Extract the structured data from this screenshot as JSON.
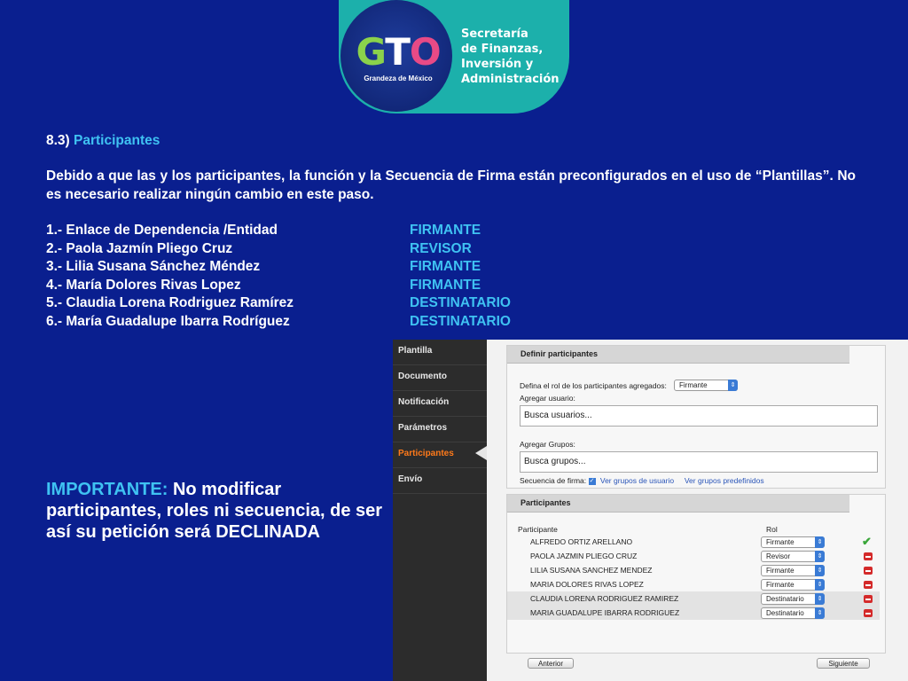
{
  "logo": {
    "brand": "GTO",
    "tagline": "Grandeza de México",
    "secretaria_lines": [
      "Secretaría",
      "de Finanzas,",
      "Inversión y",
      "Administración"
    ]
  },
  "section": {
    "number": "8.3)",
    "title": "Participantes"
  },
  "paragraph": "Debido a que las y los participantes, la función y la Secuencia de Firma están preconfigurados en el uso de “Plantillas”. No es necesario realizar ningún cambio en este paso.",
  "participants_list": [
    {
      "label": "1.- Enlace de Dependencia /Entidad",
      "role": "FIRMANTE"
    },
    {
      "label": "2.- Paola Jazmín Pliego Cruz",
      "role": "REVISOR"
    },
    {
      "label": "3.- Lilia Susana Sánchez Méndez",
      "role": "FIRMANTE"
    },
    {
      "label": "4.- María Dolores Rivas Lopez",
      "role": "FIRMANTE"
    },
    {
      "label": "5.- Claudia Lorena Rodriguez Ramírez",
      "role": "DESTINATARIO"
    },
    {
      "label": "6.- María Guadalupe Ibarra Rodríguez",
      "role": "DESTINATARIO"
    }
  ],
  "important": {
    "prefix": "IMPORTANTE:",
    "text": " No modificar participantes, roles ni secuencia, de ser así su petición será DECLINADA"
  },
  "app": {
    "nav": [
      "Plantilla",
      "Documento",
      "Notificación",
      "Parámetros",
      "Participantes",
      "Envío"
    ],
    "define": {
      "header": "Definir participantes",
      "role_label": "Defina el rol de los participantes agregados:",
      "role_value": "Firmante",
      "add_user_label": "Agregar usuario:",
      "add_user_placeholder": "Busca usuarios...",
      "add_group_label": "Agregar Grupos:",
      "add_group_placeholder": "Busca grupos...",
      "sequence_label": "Secuencia de firma:",
      "user_groups_link": "Ver grupos de usuario",
      "predefined_groups_link": "Ver grupos predefinidos"
    },
    "participants": {
      "header": "Participantes",
      "col_participant": "Participante",
      "col_role": "Rol",
      "rows": [
        {
          "name": "ALFREDO ORTIZ ARELLANO",
          "role": "Firmante",
          "status": "check"
        },
        {
          "name": "PAOLA JAZMIN PLIEGO CRUZ",
          "role": "Revisor",
          "status": "remove"
        },
        {
          "name": "LILIA SUSANA SANCHEZ MENDEZ",
          "role": "Firmante",
          "status": "remove"
        },
        {
          "name": "MARIA DOLORES RIVAS LOPEZ",
          "role": "Firmante",
          "status": "remove"
        },
        {
          "name": "CLAUDIA LORENA RODRIGUEZ RAMIREZ",
          "role": "Destinatario",
          "status": "remove"
        },
        {
          "name": "MARIA GUADALUPE IBARRA RODRIGUEZ",
          "role": "Destinatario",
          "status": "remove"
        }
      ]
    },
    "buttons": {
      "prev": "Anterior",
      "next": "Siguiente"
    }
  }
}
